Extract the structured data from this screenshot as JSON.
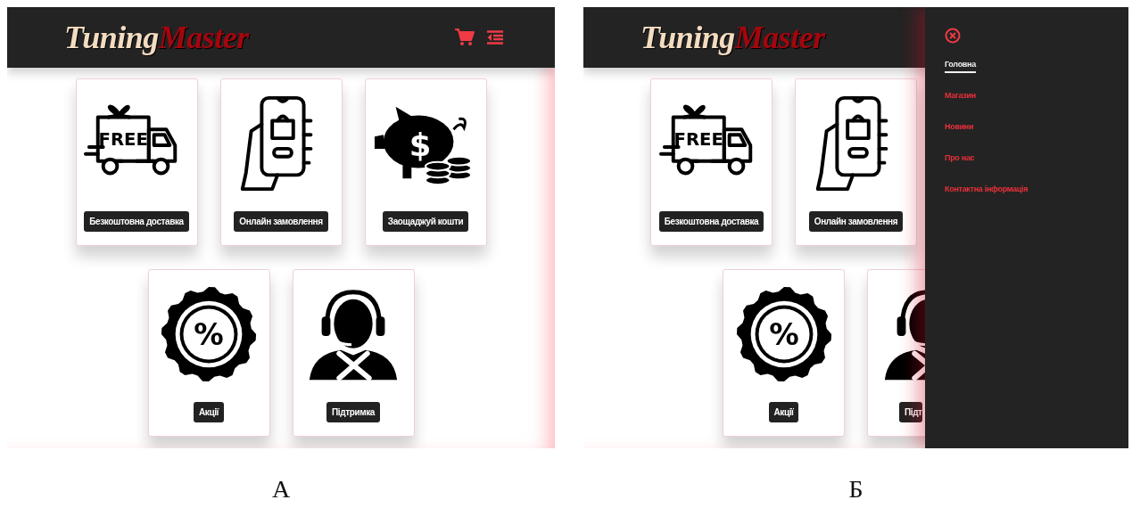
{
  "panels": [
    {
      "caption": "А",
      "header": {
        "logo_first": "Tuning",
        "logo_second": "Master"
      },
      "rows": [
        [
          {
            "kind": "truck",
            "icon_text": "FREE",
            "label": "Безкоштовна доставка",
            "clipped": false
          },
          {
            "kind": "phone",
            "label": "Онлайн замовлення",
            "clipped": false
          },
          {
            "kind": "piggy",
            "icon_text": "$",
            "label": "Заощаджуй кошти",
            "clipped": false
          }
        ],
        [
          {
            "kind": "percent",
            "icon_text": "%",
            "label": "Акції",
            "clipped": false
          },
          {
            "kind": "support",
            "label": "Підтримка",
            "clipped": false
          }
        ]
      ]
    },
    {
      "caption": "Б",
      "header": {
        "logo_first": "Tuning",
        "logo_second": "Master"
      },
      "rows": [
        [
          {
            "kind": "truck",
            "icon_text": "FREE",
            "label": "Безкоштовна доставка",
            "clipped": false
          },
          {
            "kind": "phone",
            "label": "Онлайн замовлення",
            "clipped": false
          }
        ],
        [
          {
            "kind": "percent",
            "icon_text": "%",
            "label": "Акції",
            "clipped": false
          },
          {
            "kind": "support",
            "label": "Підт",
            "clipped": true
          }
        ]
      ],
      "drawer": {
        "items": [
          {
            "label": "Головна",
            "selected": true
          },
          {
            "label": "Магазин",
            "selected": false
          },
          {
            "label": "Новини",
            "selected": false
          },
          {
            "label": "Про нас",
            "selected": false
          },
          {
            "label": "Контактна інформація",
            "selected": false
          }
        ]
      }
    }
  ]
}
